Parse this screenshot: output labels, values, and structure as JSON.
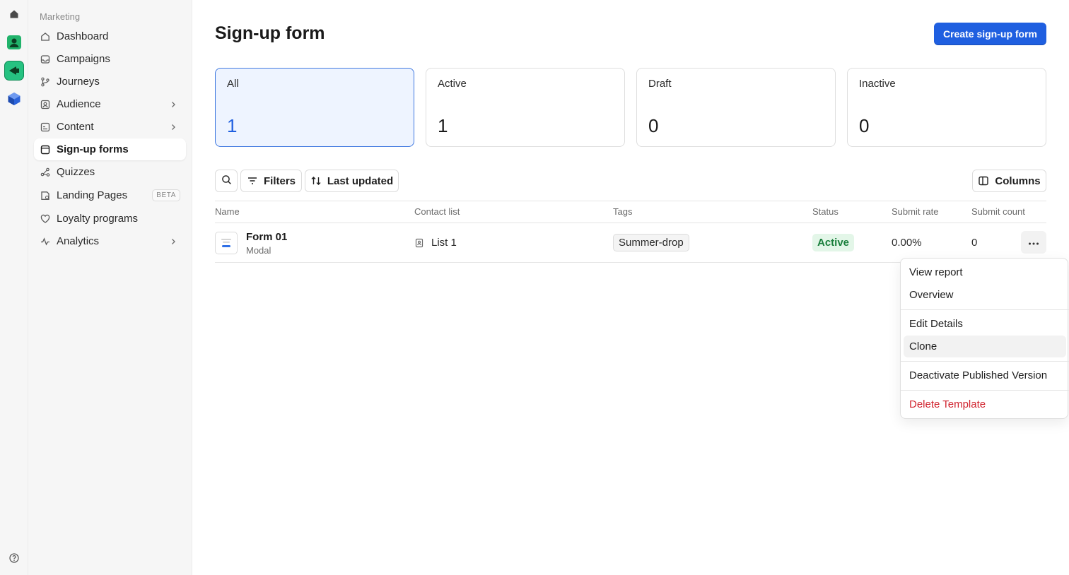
{
  "sidebar": {
    "section_label": "Marketing",
    "items": [
      {
        "label": "Dashboard",
        "icon": "home-icon"
      },
      {
        "label": "Campaigns",
        "icon": "inbox-icon"
      },
      {
        "label": "Journeys",
        "icon": "branch-icon"
      },
      {
        "label": "Audience",
        "icon": "contacts-icon",
        "has_submenu": true
      },
      {
        "label": "Content",
        "icon": "image-icon",
        "has_submenu": true
      },
      {
        "label": "Sign-up forms",
        "icon": "form-icon",
        "active": true
      },
      {
        "label": "Quizzes",
        "icon": "share-nodes-icon"
      },
      {
        "label": "Landing Pages",
        "icon": "page-icon",
        "badge": "BETA"
      },
      {
        "label": "Loyalty programs",
        "icon": "heart-icon"
      },
      {
        "label": "Analytics",
        "icon": "activity-icon",
        "has_submenu": true
      }
    ]
  },
  "header": {
    "title": "Sign-up form",
    "create_button": "Create sign-up form"
  },
  "stats": [
    {
      "label": "All",
      "value": "1",
      "selected": true
    },
    {
      "label": "Active",
      "value": "1"
    },
    {
      "label": "Draft",
      "value": "0"
    },
    {
      "label": "Inactive",
      "value": "0"
    }
  ],
  "toolbar": {
    "filters_label": "Filters",
    "sort_label": "Last updated",
    "columns_label": "Columns"
  },
  "table": {
    "columns": [
      "Name",
      "Contact list",
      "Tags",
      "Status",
      "Submit rate",
      "Submit count"
    ],
    "rows": [
      {
        "name": "Form 01",
        "type": "Modal",
        "contact_list": "List 1",
        "tag": "Summer-drop",
        "status": "Active",
        "submit_rate": "0.00%",
        "submit_count": "0"
      }
    ]
  },
  "row_menu": {
    "items": [
      "View report",
      "Overview",
      "Edit Details",
      "Clone",
      "Deactivate Published Version",
      "Delete Template"
    ],
    "highlighted": "Clone",
    "danger_color": "#d1242f"
  },
  "colors": {
    "accent": "#1f5fe0",
    "selected_card_bg": "#eef4ff",
    "status_active_bg": "#e3f6e8",
    "status_active_text": "#1a7f3c"
  }
}
